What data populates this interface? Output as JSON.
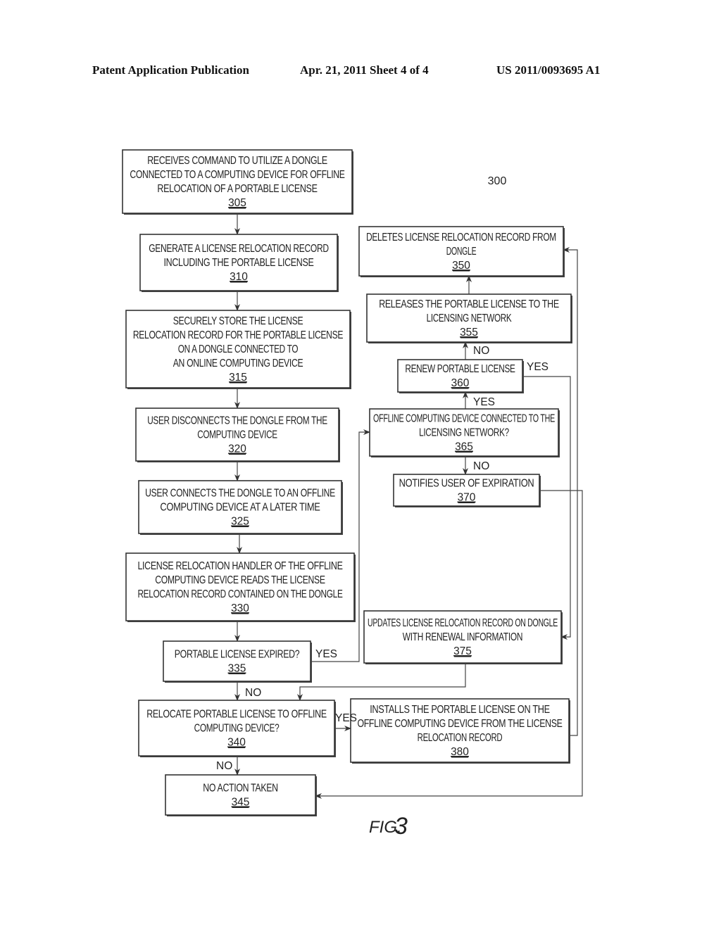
{
  "header": {
    "publication": "Patent Application Publication",
    "date_sheet": "Apr. 21, 2011  Sheet 4 of 4",
    "number": "US 2011/0093695 A1"
  },
  "figure": {
    "reference": "300",
    "caption_prefix": "FIG.",
    "caption_number": "3"
  },
  "boxes": {
    "b305": {
      "lines": [
        "RECEIVES COMMAND TO UTILIZE A DONGLE",
        "CONNECTED TO A COMPUTING DEVICE FOR OFFLINE",
        "RELOCATION OF A PORTABLE LICENSE"
      ],
      "number": "305"
    },
    "b310": {
      "lines": [
        "GENERATE A LICENSE RELOCATION RECORD",
        "INCLUDING THE PORTABLE LICENSE"
      ],
      "number": "310"
    },
    "b315": {
      "lines": [
        "SECURELY STORE THE LICENSE",
        "RELOCATION RECORD FOR THE PORTABLE LICENSE",
        "ON A DONGLE CONNECTED TO",
        "AN ONLINE COMPUTING DEVICE"
      ],
      "number": "315"
    },
    "b320": {
      "lines": [
        "USER DISCONNECTS THE DONGLE FROM THE",
        "COMPUTING DEVICE"
      ],
      "number": "320"
    },
    "b325": {
      "lines": [
        "USER CONNECTS THE DONGLE TO AN OFFLINE",
        "COMPUTING DEVICE AT A LATER TIME"
      ],
      "number": "325"
    },
    "b330": {
      "lines": [
        "LICENSE RELOCATION HANDLER OF THE OFFLINE",
        "COMPUTING DEVICE READS THE LICENSE",
        "RELOCATION RECORD CONTAINED ON THE DONGLE"
      ],
      "number": "330"
    },
    "b335": {
      "lines": [
        "PORTABLE LICENSE EXPIRED?"
      ],
      "number": "335"
    },
    "b340": {
      "lines": [
        "RELOCATE PORTABLE LICENSE TO OFFLINE",
        "COMPUTING DEVICE?"
      ],
      "number": "340"
    },
    "b345": {
      "lines": [
        "NO ACTION TAKEN"
      ],
      "number": "345"
    },
    "b350": {
      "lines": [
        "DELETES LICENSE RELOCATION RECORD FROM",
        "DONGLE"
      ],
      "number": "350"
    },
    "b355": {
      "lines": [
        "RELEASES THE PORTABLE LICENSE TO THE",
        "LICENSING NETWORK"
      ],
      "number": "355"
    },
    "b360": {
      "lines": [
        "RENEW PORTABLE LICENSE"
      ],
      "number": "360"
    },
    "b365": {
      "lines": [
        "OFFLINE COMPUTING DEVICE CONNECTED TO THE",
        "LICENSING NETWORK?"
      ],
      "number": "365"
    },
    "b370": {
      "lines": [
        "NOTIFIES USER OF EXPIRATION"
      ],
      "number": "370"
    },
    "b375": {
      "lines": [
        "UPDATES LICENSE RELOCATION RECORD ON DONGLE",
        "WITH RENEWAL INFORMATION"
      ],
      "number": "375"
    },
    "b380": {
      "lines": [
        "INSTALLS THE PORTABLE LICENSE ON THE",
        "OFFLINE COMPUTING DEVICE FROM THE LICENSE",
        "RELOCATION RECORD"
      ],
      "number": "380"
    }
  },
  "edge_labels": {
    "e335_yes": "YES",
    "e335_no": "NO",
    "e340_yes": "YES",
    "e340_no": "NO",
    "e365_yes": "YES",
    "e365_no": "NO",
    "e360_no": "NO",
    "e360_yes": "YES"
  }
}
